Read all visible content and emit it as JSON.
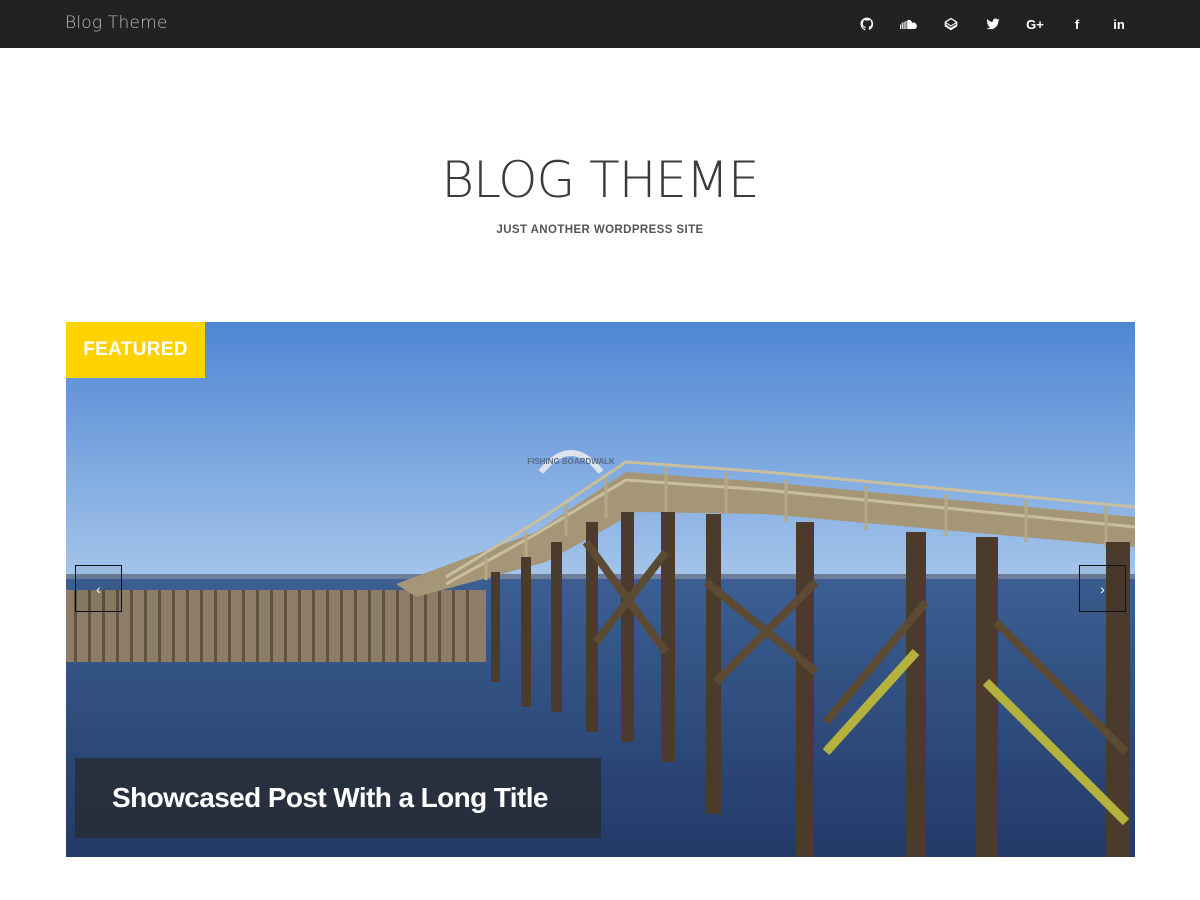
{
  "topbar": {
    "brand": "Blog Theme",
    "social": [
      {
        "name": "github-icon",
        "glyph": ""
      },
      {
        "name": "soundcloud-icon",
        "glyph": ""
      },
      {
        "name": "codepen-icon",
        "glyph": ""
      },
      {
        "name": "twitter-icon",
        "glyph": ""
      },
      {
        "name": "google-plus-icon",
        "glyph": "G+"
      },
      {
        "name": "facebook-icon",
        "glyph": "f"
      },
      {
        "name": "linkedin-icon",
        "glyph": "in"
      }
    ]
  },
  "header": {
    "title": "BLOG THEME",
    "tagline": "JUST ANOTHER WORDPRESS SITE"
  },
  "slider": {
    "badge": "FEATURED",
    "prev_glyph": "‹",
    "next_glyph": "›",
    "caption": "Showcased Post With a Long Title",
    "sign_text": "FISHING BOARDWALK"
  },
  "colors": {
    "topbar_bg": "#222222",
    "badge_bg": "#ffd200",
    "sky": "#6fa3de",
    "water": "#3e5e8f"
  }
}
